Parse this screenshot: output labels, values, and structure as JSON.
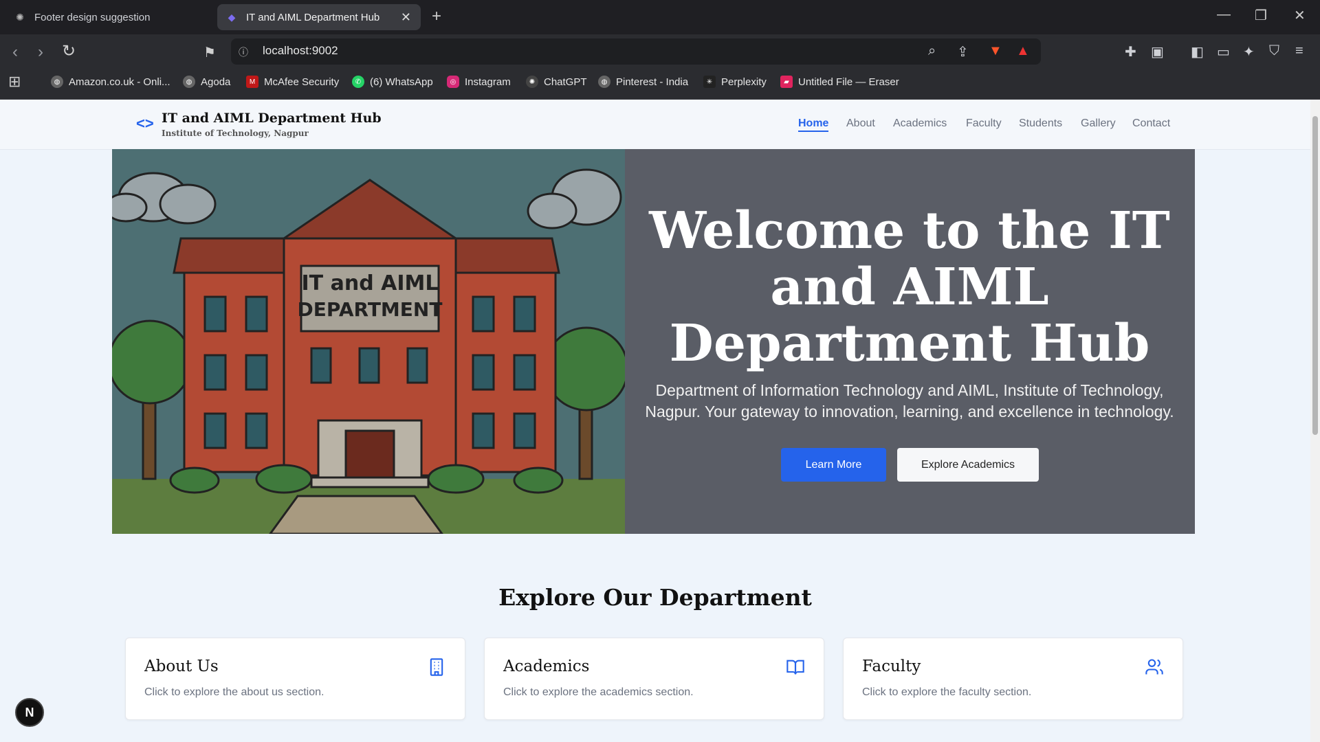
{
  "browser": {
    "tabs": [
      {
        "title": "Footer design suggestion",
        "icon": "chatgpt-icon"
      },
      {
        "title": "IT and AIML Department Hub",
        "icon": "site-favicon"
      }
    ],
    "url": "localhost:9002",
    "bookmarks": [
      {
        "label": "Amazon.co.uk - Onli...",
        "icon": "globe-icon"
      },
      {
        "label": "Agoda",
        "icon": "globe-icon"
      },
      {
        "label": "McAfee Security",
        "icon": "mcafee-icon"
      },
      {
        "label": "(6) WhatsApp",
        "icon": "whatsapp-icon"
      },
      {
        "label": "Instagram",
        "icon": "instagram-icon"
      },
      {
        "label": "ChatGPT",
        "icon": "chatgpt-icon"
      },
      {
        "label": "Pinterest - India",
        "icon": "globe-icon"
      },
      {
        "label": "Perplexity",
        "icon": "perplexity-icon"
      },
      {
        "label": "Untitled File — Eraser",
        "icon": "eraser-icon"
      }
    ]
  },
  "site": {
    "title": "IT and AIML Department Hub",
    "subtitle": "Institute of Technology, Nagpur",
    "nav": [
      "Home",
      "About",
      "Academics",
      "Faculty",
      "Students",
      "Gallery",
      "Contact"
    ],
    "active_nav": "Home",
    "accent_color": "#2563eb"
  },
  "hero": {
    "image_sign_text": "IT and AIML DEPARTMENT",
    "title": "Welcome to the IT and AIML Department Hub",
    "description": "Department of Information Technology and AIML, Institute of Technology, Nagpur. Your gateway to innovation, learning, and excellence in technology.",
    "primary_button": "Learn More",
    "secondary_button": "Explore Academics"
  },
  "explore": {
    "title": "Explore Our Department",
    "cards": [
      {
        "title": "About Us",
        "description": "Click to explore the about us section.",
        "icon": "building-icon"
      },
      {
        "title": "Academics",
        "description": "Click to explore the academics section.",
        "icon": "book-open-icon"
      },
      {
        "title": "Faculty",
        "description": "Click to explore the faculty section.",
        "icon": "users-icon"
      }
    ]
  },
  "badge": "N"
}
